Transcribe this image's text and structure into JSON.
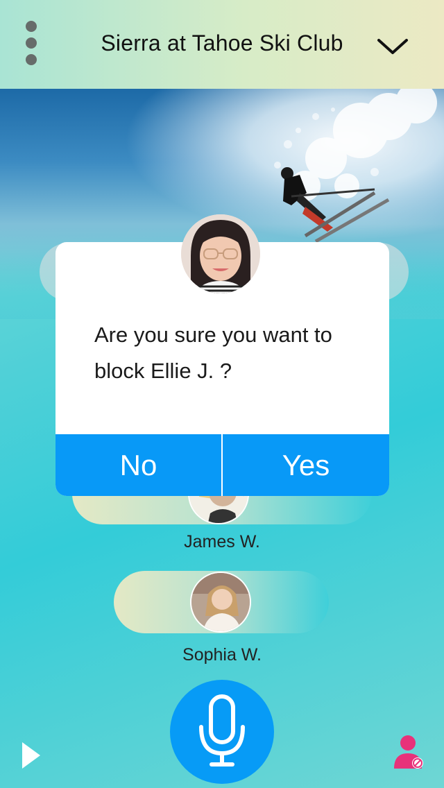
{
  "header": {
    "title": "Sierra at Tahoe Ski Club",
    "menu_icon": "more-vertical-icon",
    "dropdown_icon": "chevron-down-icon"
  },
  "dialog": {
    "message": "Are you sure you want to block Ellie J. ?",
    "no_label": "No",
    "yes_label": "Yes"
  },
  "members": [
    {
      "name": "James W."
    },
    {
      "name": "Sophia W."
    }
  ],
  "controls": {
    "mic_icon": "microphone-icon",
    "play_icon": "play-icon",
    "block_icon": "block-user-icon"
  },
  "colors": {
    "accent": "#0899f7",
    "block_icon": "#e8327a"
  }
}
